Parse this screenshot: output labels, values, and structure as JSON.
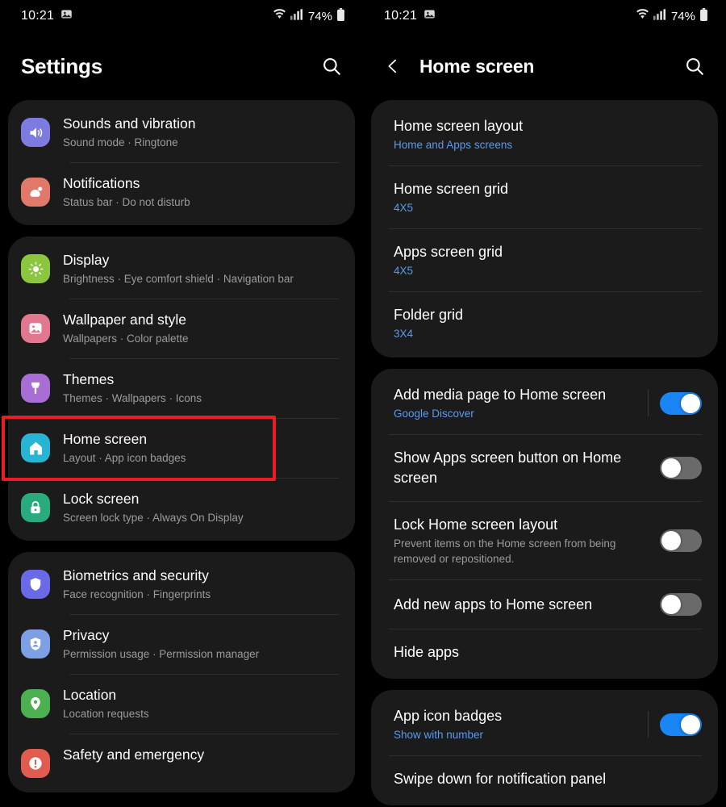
{
  "status_bar": {
    "time": "10:21",
    "icons": [
      "image-icon",
      "wifi-icon",
      "cellular-signal-icon"
    ],
    "battery_percent": "74%"
  },
  "left_screen": {
    "header": {
      "title": "Settings",
      "search_icon": "search-icon"
    },
    "groups": [
      {
        "items": [
          {
            "title": "Sounds and vibration",
            "subtitle": "Sound mode  ·  Ringtone",
            "icon": "sound-icon",
            "icon_color": "#7d7ae0"
          },
          {
            "title": "Notifications",
            "subtitle": "Status bar  ·  Do not disturb",
            "icon": "notifications-icon",
            "icon_color": "#e0796a"
          }
        ]
      },
      {
        "items": [
          {
            "title": "Display",
            "subtitle": "Brightness  ·  Eye comfort shield  ·  Navigation bar",
            "icon": "display-icon",
            "icon_color": "#8cc63e"
          },
          {
            "title": "Wallpaper and style",
            "subtitle": "Wallpapers  ·  Color palette",
            "icon": "wallpaper-icon",
            "icon_color": "#e2788f"
          },
          {
            "title": "Themes",
            "subtitle": "Themes  ·  Wallpapers  ·  Icons",
            "icon": "themes-icon",
            "icon_color": "#a96ed6"
          },
          {
            "title": "Home screen",
            "subtitle": "Layout  ·  App icon badges",
            "icon": "home-icon",
            "icon_color": "#28b5d4",
            "highlighted": true
          },
          {
            "title": "Lock screen",
            "subtitle": "Screen lock type  ·  Always On Display",
            "icon": "lock-icon",
            "icon_color": "#2aab7e"
          }
        ]
      },
      {
        "items": [
          {
            "title": "Biometrics and security",
            "subtitle": "Face recognition  ·  Fingerprints",
            "icon": "shield-icon",
            "icon_color": "#6a6ae6"
          },
          {
            "title": "Privacy",
            "subtitle": "Permission usage  ·  Permission manager",
            "icon": "privacy-icon",
            "icon_color": "#7d9fe3"
          },
          {
            "title": "Location",
            "subtitle": "Location requests",
            "icon": "location-pin-icon",
            "icon_color": "#4caf50"
          },
          {
            "title": "Safety and emergency",
            "subtitle": "",
            "icon": "safety-icon",
            "icon_color": "#e05c4f"
          }
        ]
      }
    ]
  },
  "right_screen": {
    "header": {
      "title": "Home screen",
      "back_icon": "back-chevron-icon",
      "search_icon": "search-icon"
    },
    "groups": [
      {
        "items": [
          {
            "title": "Home screen layout",
            "subtitle": "Home and Apps screens",
            "subtitle_accent": true
          },
          {
            "title": "Home screen grid",
            "subtitle": "4X5",
            "subtitle_accent": true
          },
          {
            "title": "Apps screen grid",
            "subtitle": "4X5",
            "subtitle_accent": true
          },
          {
            "title": "Folder grid",
            "subtitle": "3X4",
            "subtitle_accent": true
          }
        ]
      },
      {
        "items": [
          {
            "title": "Add media page to Home screen",
            "subtitle": "Google Discover",
            "subtitle_accent": true,
            "toggle": "on",
            "divider": true
          },
          {
            "title": "Show Apps screen button on Home screen",
            "subtitle": "",
            "toggle": "off"
          },
          {
            "title": "Lock Home screen layout",
            "subtitle": "Prevent items on the Home screen from being removed or repositioned.",
            "toggle": "off"
          },
          {
            "title": "Add new apps to Home screen",
            "subtitle": "",
            "toggle": "off"
          },
          {
            "title": "Hide apps",
            "subtitle": ""
          }
        ]
      },
      {
        "items": [
          {
            "title": "App icon badges",
            "subtitle": "Show with number",
            "subtitle_accent": true,
            "toggle": "on",
            "divider": true
          },
          {
            "title": "Swipe down for notification panel",
            "subtitle": ""
          }
        ]
      }
    ]
  },
  "colors": {
    "accent_blue": "#5a9bec",
    "toggle_on": "#1a85f5",
    "toggle_off": "#6a6a6a",
    "card_bg": "#1b1b1b",
    "highlight_red": "#ec1c24"
  }
}
